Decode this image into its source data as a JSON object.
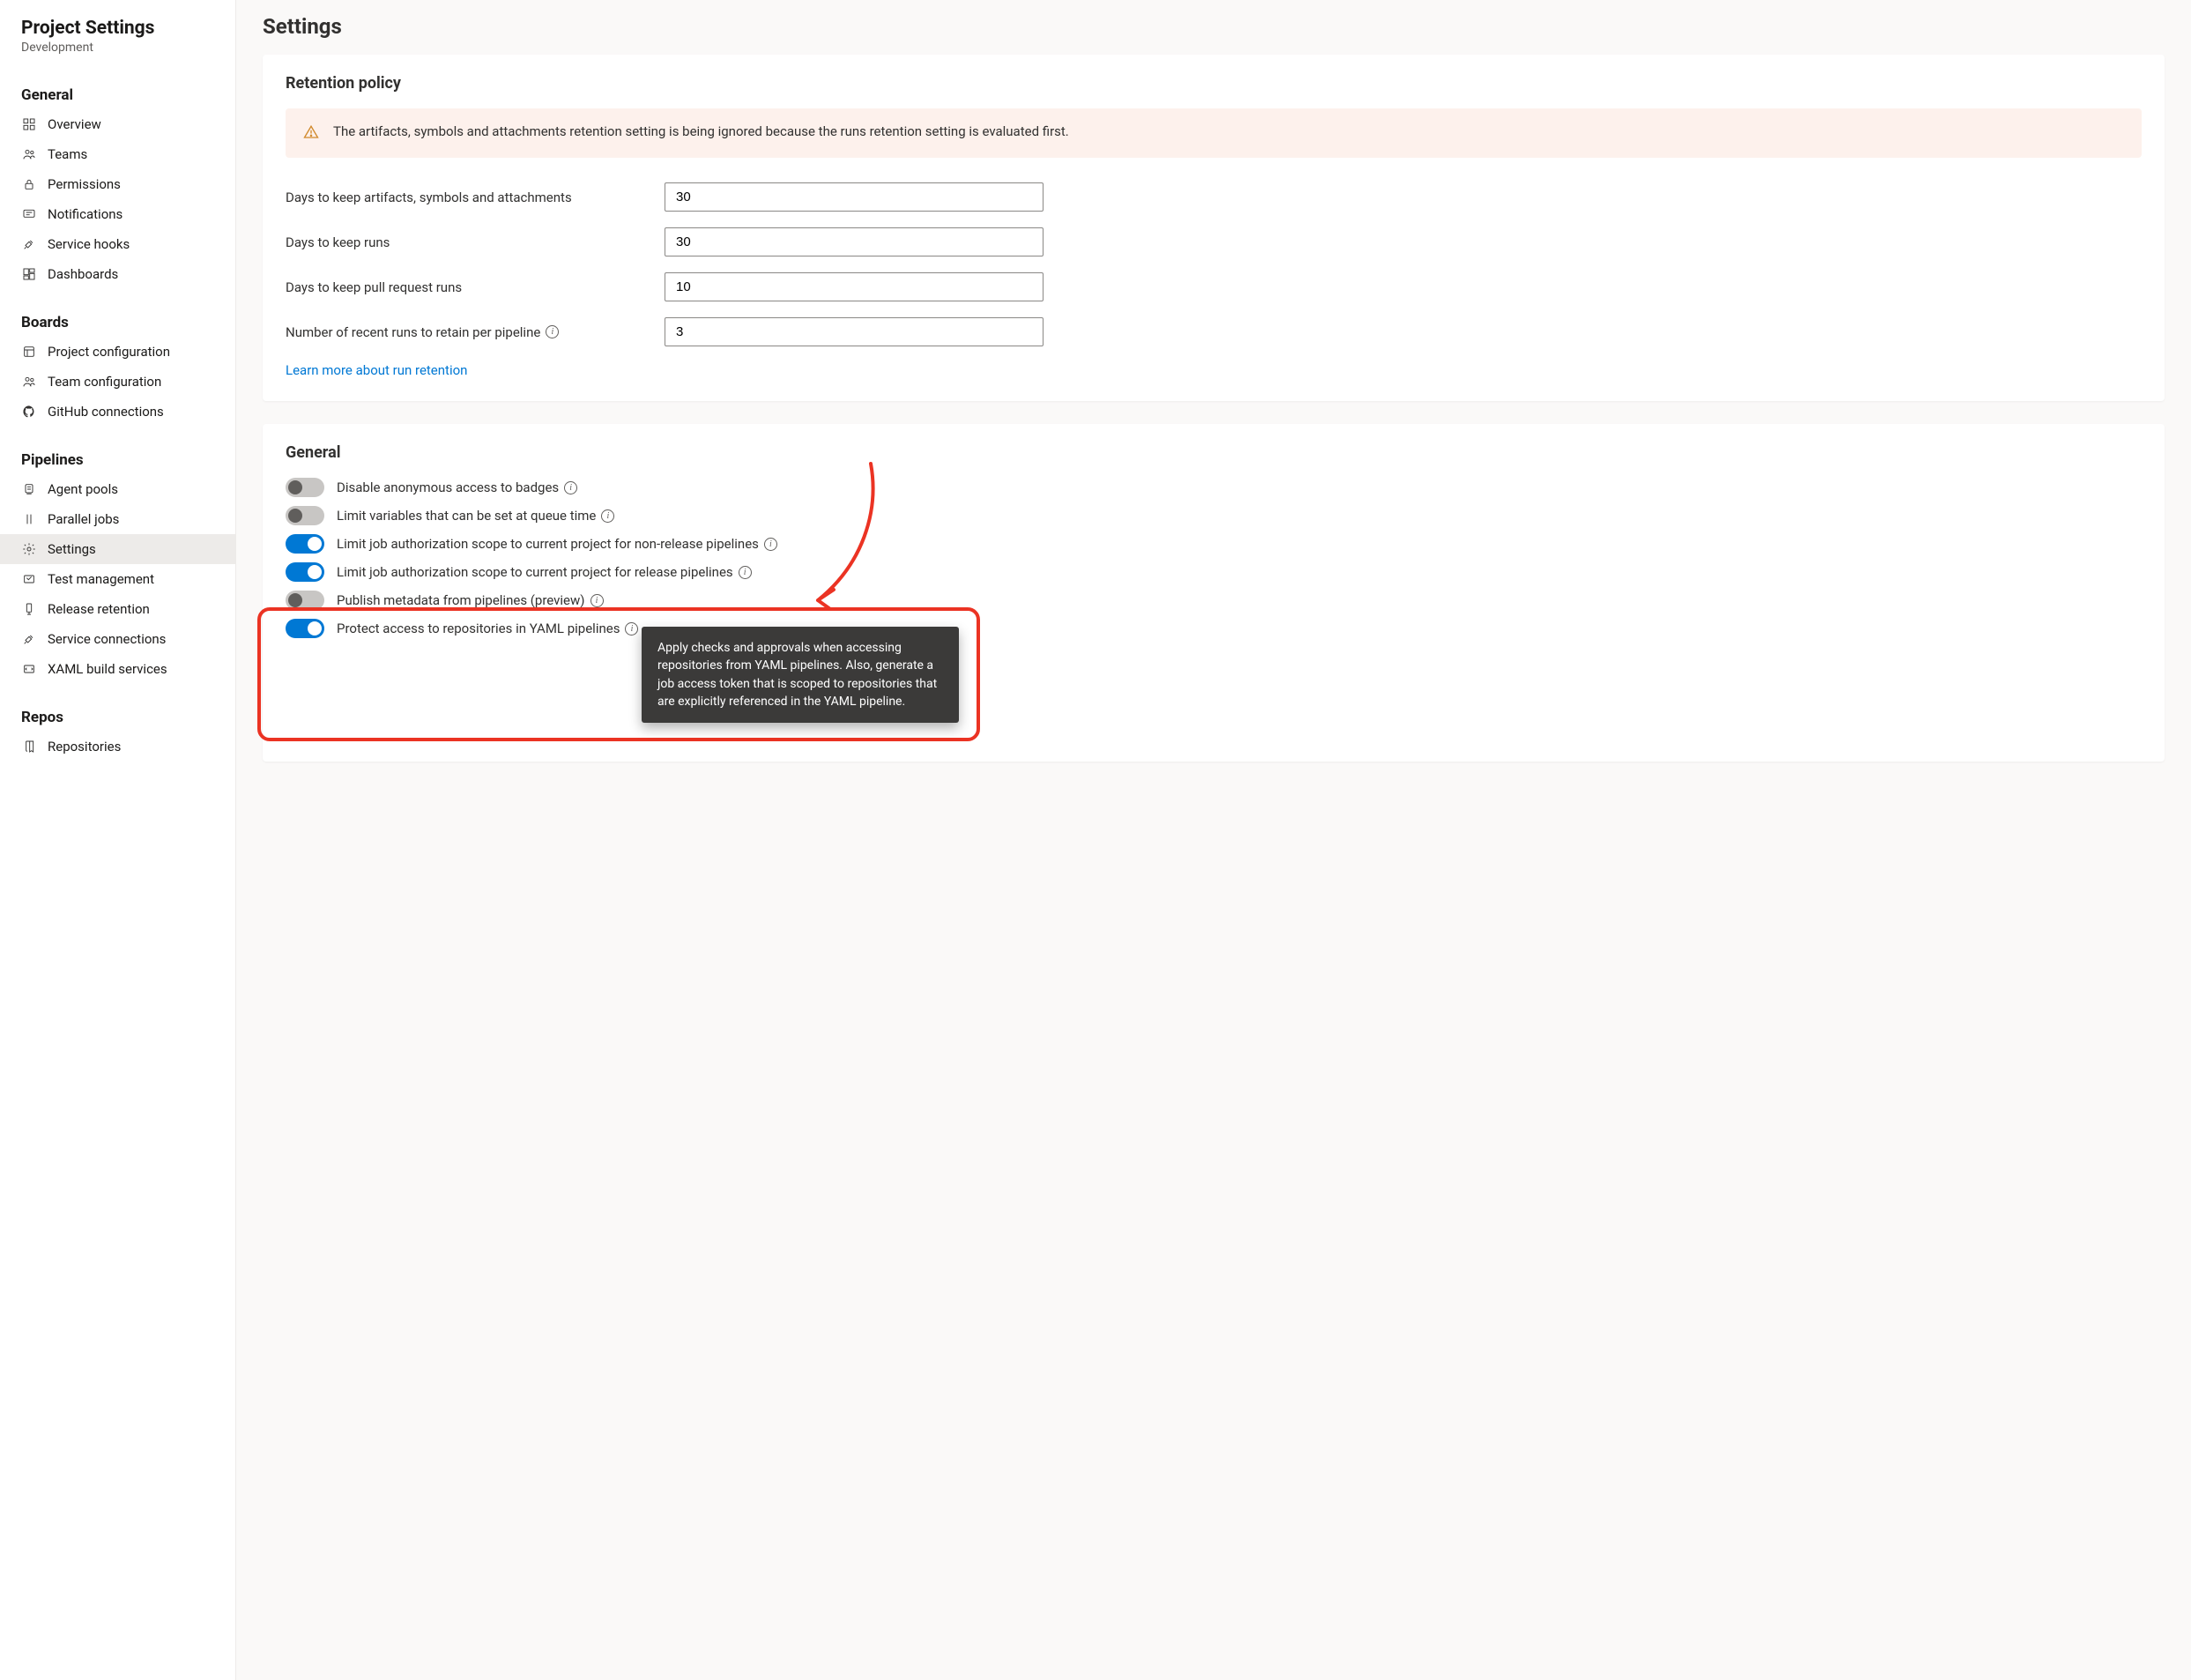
{
  "sidebar": {
    "title": "Project Settings",
    "subtitle": "Development",
    "sections": [
      {
        "heading": "General",
        "items": [
          {
            "label": "Overview",
            "icon": "grid"
          },
          {
            "label": "Teams",
            "icon": "teams"
          },
          {
            "label": "Permissions",
            "icon": "lock"
          },
          {
            "label": "Notifications",
            "icon": "chat"
          },
          {
            "label": "Service hooks",
            "icon": "plug"
          },
          {
            "label": "Dashboards",
            "icon": "dashboard"
          }
        ]
      },
      {
        "heading": "Boards",
        "items": [
          {
            "label": "Project configuration",
            "icon": "project"
          },
          {
            "label": "Team configuration",
            "icon": "teams"
          },
          {
            "label": "GitHub connections",
            "icon": "github"
          }
        ]
      },
      {
        "heading": "Pipelines",
        "items": [
          {
            "label": "Agent pools",
            "icon": "agent"
          },
          {
            "label": "Parallel jobs",
            "icon": "parallel"
          },
          {
            "label": "Settings",
            "icon": "gear",
            "active": true
          },
          {
            "label": "Test management",
            "icon": "test"
          },
          {
            "label": "Release retention",
            "icon": "release"
          },
          {
            "label": "Service connections",
            "icon": "plug"
          },
          {
            "label": "XAML build services",
            "icon": "xaml"
          }
        ]
      },
      {
        "heading": "Repos",
        "items": [
          {
            "label": "Repositories",
            "icon": "repo"
          }
        ]
      }
    ]
  },
  "page": {
    "title": "Settings"
  },
  "retention": {
    "title": "Retention policy",
    "alert": "The artifacts, symbols and attachments retention setting is being ignored because the runs retention setting is evaluated first.",
    "fields": {
      "artifacts_label": "Days to keep artifacts, symbols and attachments",
      "artifacts_value": "30",
      "runs_label": "Days to keep runs",
      "runs_value": "30",
      "pr_runs_label": "Days to keep pull request runs",
      "pr_runs_value": "10",
      "recent_label": "Number of recent runs to retain per pipeline",
      "recent_value": "3"
    },
    "link": "Learn more about run retention"
  },
  "general": {
    "title": "General",
    "toggles": [
      {
        "label": "Disable anonymous access to badges",
        "on": false
      },
      {
        "label": "Limit variables that can be set at queue time",
        "on": false
      },
      {
        "label": "Limit job authorization scope to current project for non-release pipelines",
        "on": true
      },
      {
        "label": "Limit job authorization scope to current project for release pipelines",
        "on": true
      },
      {
        "label": "Publish metadata from pipelines (preview)",
        "on": false
      },
      {
        "label": "Protect access to repositories in YAML pipelines",
        "on": true
      }
    ],
    "tooltip": "Apply checks and approvals when accessing repositories from YAML pipelines. Also, generate a job access token that is scoped to repositories that are explicitly referenced in the YAML pipeline."
  }
}
